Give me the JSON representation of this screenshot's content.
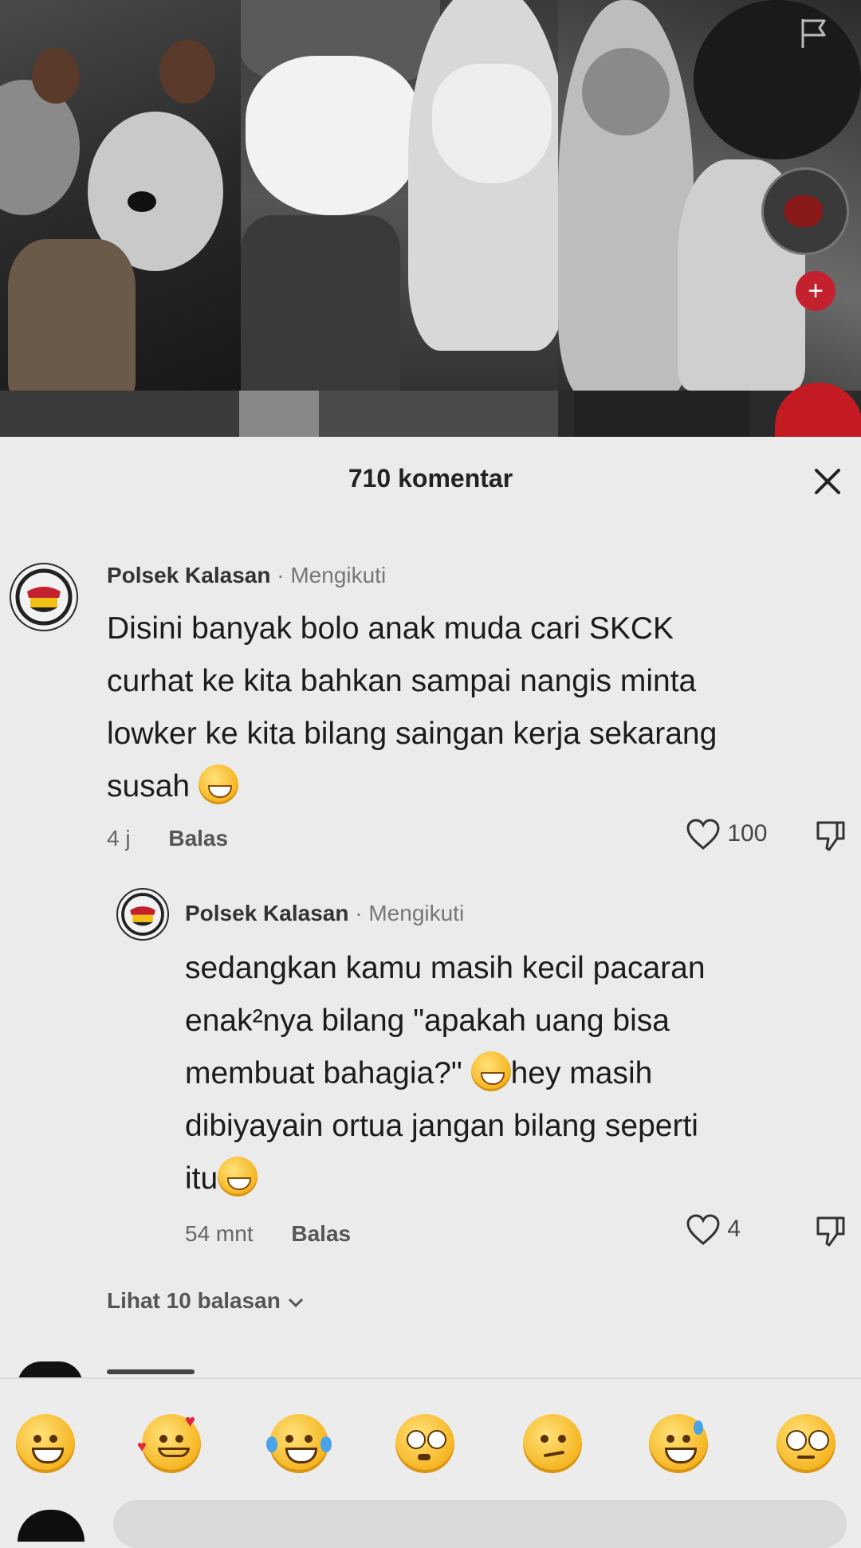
{
  "sheet": {
    "title": "710 komentar"
  },
  "comments": [
    {
      "username": "Polsek Kalasan",
      "separator": "·",
      "follow_status": "Mengikuti",
      "lines": [
        "Disini banyak bolo anak muda cari SKCK",
        "curhat ke kita bahkan sampai nangis minta",
        "lowker ke kita bilang saingan kerja sekarang",
        "susah"
      ],
      "time": "4 j",
      "reply_label": "Balas",
      "likes": "100"
    },
    {
      "username": "Polsek Kalasan",
      "separator": "·",
      "follow_status": "Mengikuti",
      "lines": [
        "sedangkan kamu masih kecil pacaran",
        "enak²nya bilang \"apakah uang bisa",
        "membuat bahagia?\"",
        "hey masih",
        "dibiyayain ortua jangan bilang seperti",
        "itu"
      ],
      "time": "54 mnt",
      "reply_label": "Balas",
      "likes": "4"
    }
  ],
  "view_replies_label": "Lihat 10 balasan",
  "emoji_bar": [
    "grinning-face",
    "smiling-face-with-hearts",
    "face-with-tears-of-joy",
    "flushed-face",
    "smirking-face",
    "grinning-sweat-face",
    "pleading-face"
  ],
  "colors": {
    "background": "#ebebeb",
    "accent_red": "#c4212f"
  }
}
